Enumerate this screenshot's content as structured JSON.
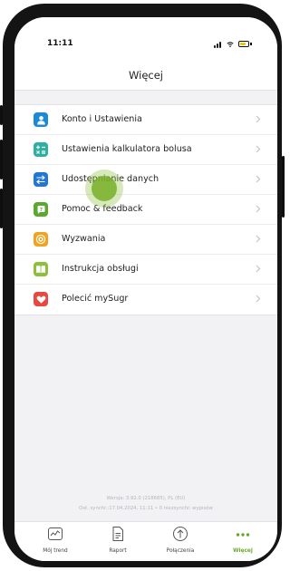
{
  "status_bar": {
    "time": "11:11"
  },
  "header": {
    "title": "Więcej"
  },
  "menu": {
    "items": [
      {
        "label": "Konto i Ustawienia",
        "icon": "person-icon",
        "color": "#1a8ad4"
      },
      {
        "label": "Ustawienia kalkulatora bolusa",
        "icon": "calculator-icon",
        "color": "#2bb0a2"
      },
      {
        "label": "Udostępnianie danych",
        "icon": "share-arrows-icon",
        "color": "#2277d4"
      },
      {
        "label": "Pomoc & feedback",
        "icon": "help-icon",
        "color": "#5aa82e"
      },
      {
        "label": "Wyzwania",
        "icon": "challenge-icon",
        "color": "#f2a21c"
      },
      {
        "label": "Instrukcja obsługi",
        "icon": "book-icon",
        "color": "#8bbf3c"
      },
      {
        "label": "Polecić mySugr",
        "icon": "heart-icon",
        "color": "#e8483f"
      }
    ]
  },
  "footer": {
    "version_line1": "Wersja: 3.92.0 (218685), PL (EU)",
    "version_line2": "Ost. synchr.:17.04.2024, 11:11 • 0 niezsynchr. wypisów"
  },
  "tabbar": {
    "tabs": [
      {
        "label": "Mój trend",
        "icon": "trend-graph-icon"
      },
      {
        "label": "Raport",
        "icon": "report-document-icon"
      },
      {
        "label": "Połączenia",
        "icon": "connections-upload-icon"
      },
      {
        "label": "Więcej",
        "icon": "more-dots-icon",
        "active": true
      }
    ]
  },
  "colors": {
    "accent_active": "#6aa82c",
    "chevron": "#c4c4c8"
  }
}
